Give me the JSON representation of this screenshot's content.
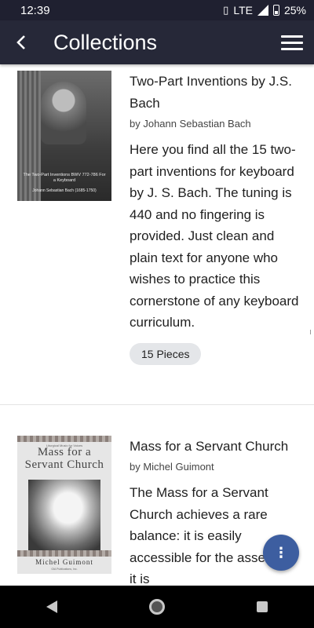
{
  "status_bar": {
    "time": "12:39",
    "network": "LTE",
    "battery": "25%"
  },
  "app_bar": {
    "back_icon": "arrow-back-icon",
    "title": "Collections",
    "menu_icon": "hamburger-menu-icon"
  },
  "collections": [
    {
      "title": "Two-Part Inventions by J.S. Bach",
      "author": "by Johann Sebastian Bach",
      "description": "Here you find all the 15 two-part inventions for keyboard by J. S. Bach. The tuning is 440 and no fingering is provided. Just clean and plain text for anyone who wishes to practice this cornerstone of any keyboard curriculum.",
      "pieces": "15 Pieces",
      "cover": {
        "title": "The Two-Part Inventions BWV 772-786 For a Keyboard",
        "subtitle": "Johann Sebastian Bach (1685-1750)"
      }
    },
    {
      "title": "Mass for a Servant Church",
      "author": "by Michel Guimont",
      "description": "The Mass for a Servant Church achieves a rare balance: it is easily accessible for the assembly, it is",
      "cover": {
        "small_text": "Liturgical Music for Voices",
        "title": "Mass for a Servant Church",
        "author": "Michel Guimont",
        "publisher": "GIA Publications, Inc."
      }
    }
  ],
  "fab": {
    "icon": "more-vertical-icon",
    "label": "⋮"
  },
  "nav_bar": {
    "back_icon": "nav-back-icon",
    "home_icon": "nav-home-icon",
    "recent_icon": "nav-recents-icon"
  },
  "colors": {
    "status_bar": "#1f2030",
    "app_bar": "#262838",
    "chip": "#e4e6e9",
    "fab": "#3d5ea0"
  }
}
